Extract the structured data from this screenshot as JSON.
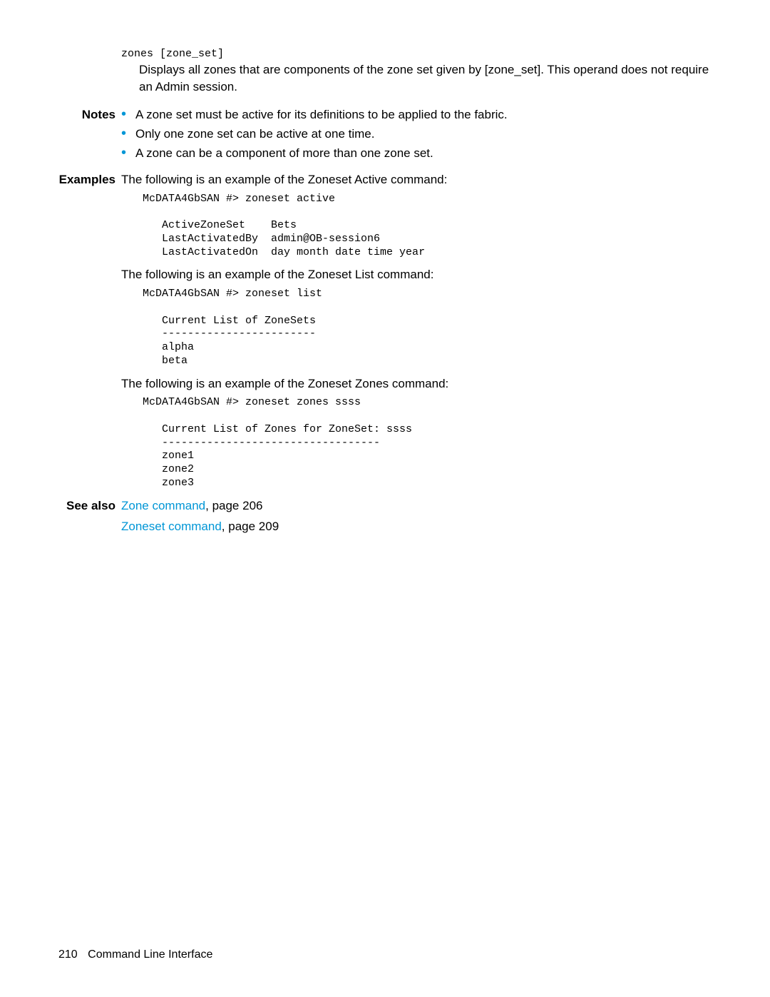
{
  "zones_cmd": {
    "syntax": "zones [zone_set]",
    "description": "Displays all zones that are components of the zone set given by [zone_set]. This operand does not require an Admin session."
  },
  "notes": {
    "label": "Notes",
    "items": [
      "A zone set must be active for its definitions to be applied to the fabric.",
      "Only one zone set can be active at one time.",
      "A zone can be a component of more than one zone set."
    ]
  },
  "examples": {
    "label": "Examples",
    "intro_active": "The following is an example of the Zoneset Active command:",
    "code_active": "McDATA4GbSAN #> zoneset active\n\n   ActiveZoneSet    Bets\n   LastActivatedBy  admin@OB-session6\n   LastActivatedOn  day month date time year",
    "intro_list": "The following is an example of the Zoneset List command:",
    "code_list": "McDATA4GbSAN #> zoneset list\n\n   Current List of ZoneSets\n   ------------------------\n   alpha\n   beta",
    "intro_zones": "The following is an example of the Zoneset Zones command:",
    "code_zones": "McDATA4GbSAN #> zoneset zones ssss\n\n   Current List of Zones for ZoneSet: ssss\n   ----------------------------------\n   zone1\n   zone2\n   zone3"
  },
  "see_also": {
    "label": "See also",
    "items": [
      {
        "link": "Zone command",
        "suffix": ", page 206"
      },
      {
        "link": "Zoneset command",
        "suffix": ", page 209"
      }
    ]
  },
  "footer": {
    "page_num": "210",
    "title": "Command Line Interface"
  }
}
